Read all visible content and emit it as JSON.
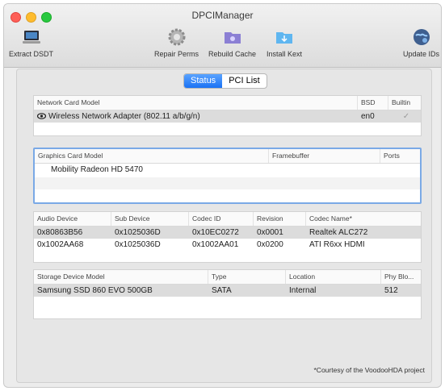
{
  "window": {
    "title": "DPCIManager"
  },
  "toolbar": {
    "extract_dsdt": "Extract DSDT",
    "repair_perms": "Repair Perms",
    "rebuild_cache": "Rebuild Cache",
    "install_kext": "Install Kext",
    "update_ids": "Update IDs"
  },
  "tabs": {
    "status": "Status",
    "pci_list": "PCI List",
    "selected": "Status"
  },
  "network": {
    "headers": [
      "Network Card Model",
      "BSD",
      "Builtin"
    ],
    "rows": [
      {
        "model": "Wireless Network Adapter (802.11 a/b/g/n)",
        "bsd": "en0",
        "builtin": "✓"
      }
    ]
  },
  "graphics": {
    "headers": [
      "Graphics Card Model",
      "Framebuffer",
      "Ports"
    ],
    "rows": [
      {
        "model": "Mobility Radeon HD 5470",
        "framebuffer": "",
        "ports": ""
      }
    ]
  },
  "audio": {
    "headers": [
      "Audio Device",
      "Sub Device",
      "Codec ID",
      "Revision",
      "Codec Name*"
    ],
    "rows": [
      {
        "device": "0x80863B56",
        "sub": "0x1025036D",
        "codec_id": "0x10EC0272",
        "revision": "0x0001",
        "codec_name": "Realtek ALC272"
      },
      {
        "device": "0x1002AA68",
        "sub": "0x1025036D",
        "codec_id": "0x1002AA01",
        "revision": "0x0200",
        "codec_name": "ATI R6xx HDMI"
      }
    ]
  },
  "storage": {
    "headers": [
      "Storage Device Model",
      "Type",
      "Location",
      "Phy Blo..."
    ],
    "rows": [
      {
        "model": "Samsung SSD 860 EVO 500GB",
        "type": "SATA",
        "location": "Internal",
        "phy": "512"
      }
    ]
  },
  "footer": {
    "courtesy": "*Courtesy of the VoodooHDA project"
  }
}
